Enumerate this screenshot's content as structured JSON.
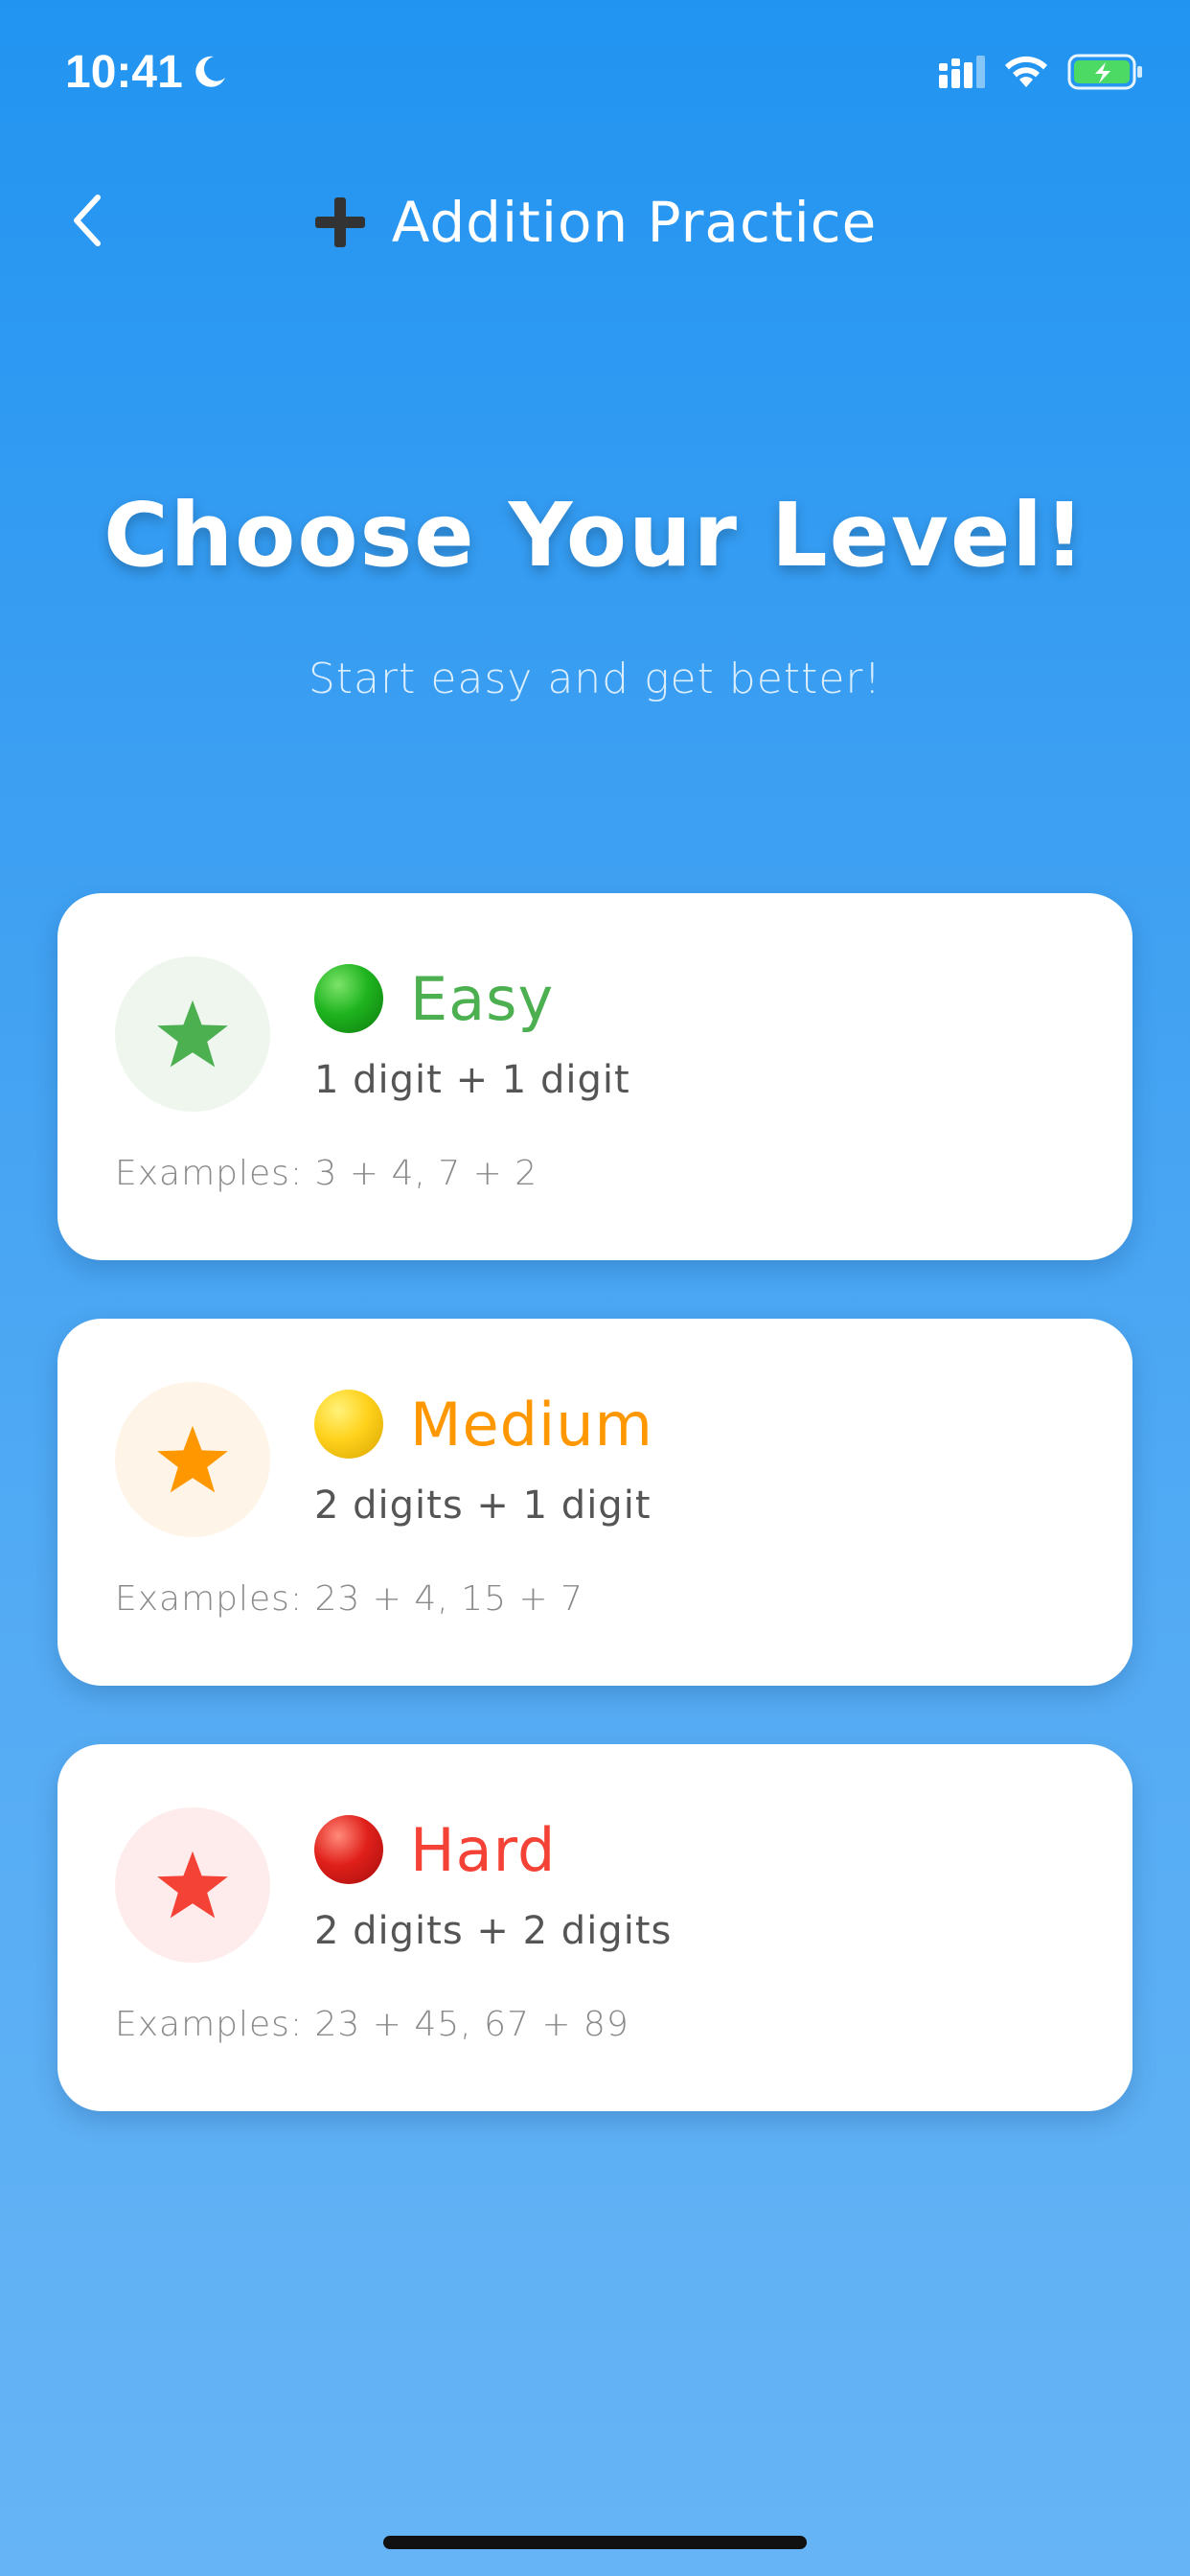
{
  "status_bar": {
    "time": "10:41",
    "icons": [
      "moon-icon",
      "cellular-signal-icon",
      "wifi-icon",
      "battery-charging-icon"
    ]
  },
  "nav": {
    "back_icon": "chevron-left-icon",
    "title_icon": "plus-icon",
    "title": "Addition Practice"
  },
  "header": {
    "title": "Choose Your Level!",
    "subtitle": "Start easy and get better!"
  },
  "levels": [
    {
      "title": "Easy",
      "description": "1 digit + 1 digit",
      "examples": "Examples: 3 + 4, 7 + 2",
      "icon": "star-icon",
      "indicator": "green-circle-icon",
      "color": "#4CAF50",
      "badge_bg": "#EEF6EE"
    },
    {
      "title": "Medium",
      "description": "2 digits + 1 digit",
      "examples": "Examples: 23 + 4, 15 + 7",
      "icon": "star-icon",
      "indicator": "yellow-circle-icon",
      "color": "#FF9800",
      "badge_bg": "#FFF4E8"
    },
    {
      "title": "Hard",
      "description": "2 digits + 2 digits",
      "examples": "Examples: 23 + 45, 67 + 89",
      "icon": "star-icon",
      "indicator": "red-circle-icon",
      "color": "#F44336",
      "badge_bg": "#FDECEB"
    }
  ],
  "colors": {
    "background_top": "#2194F1",
    "background_bottom": "#66B4F5",
    "text_primary": "#FFFFFF",
    "card_bg": "#FFFFFF"
  }
}
